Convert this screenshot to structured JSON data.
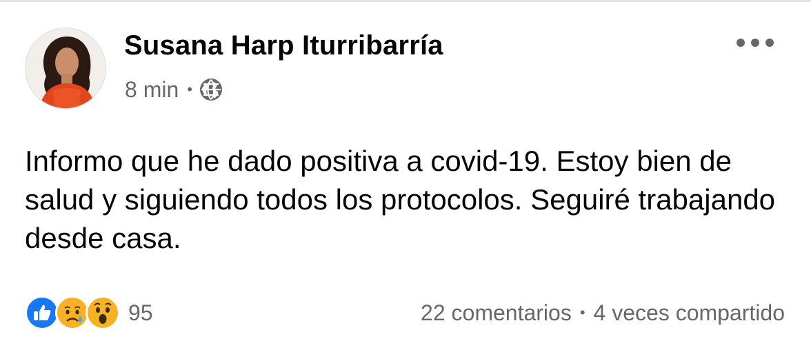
{
  "post": {
    "author": "Susana Harp Iturribarría",
    "time": "8 min",
    "meta_separator": "•",
    "privacy_icon": "globe-icon",
    "text": "Informo que he dado positiva a covid-19. Estoy bien de salud y siguiendo todos los protocolos. Seguiré trabajando desde casa.",
    "more_icon": "more-options-icon"
  },
  "footer": {
    "reaction_icons": [
      "like-icon",
      "sad-icon",
      "wow-icon"
    ],
    "reaction_count": "95",
    "comments": "22 comentarios",
    "stat_separator": "•",
    "shares": "4 veces compartido"
  },
  "colors": {
    "text_primary": "#050505",
    "text_secondary": "#65676b",
    "like_blue": "#1877f2",
    "emoji_yellow": "#f7b125"
  }
}
